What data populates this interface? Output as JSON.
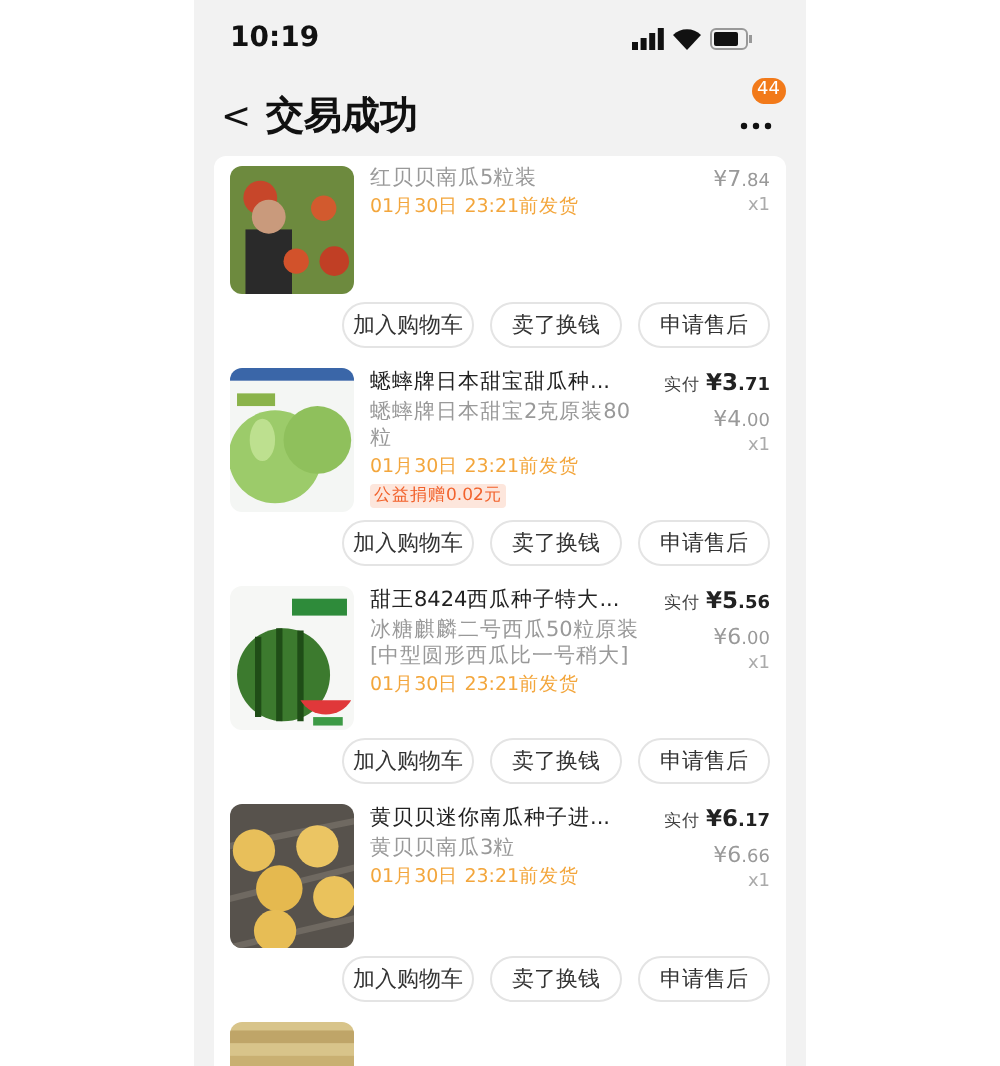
{
  "status_bar": {
    "time": "10:19"
  },
  "header": {
    "back": "<",
    "title": "交易成功",
    "more_badge": "44"
  },
  "items": [
    {
      "spec": "红贝贝南瓜5粒装",
      "price": "¥7.84",
      "quantity": "x1",
      "ship_date": "01月30日 23:21前发货",
      "picture": {
        "kind": "picture"
      },
      "buttons": [
        "加入购物车",
        "卖了换钱",
        "申请售后"
      ]
    },
    {
      "title": "蟋蟀牌日本甜宝甜瓜种...",
      "paid_label": "实付",
      "paid_price": "¥3.71",
      "spec": "蟋蟀牌日本甜宝2克原装80粒",
      "price": "¥4.00",
      "quantity": "x1",
      "ship_date": "01月30日 23:21前发货",
      "tag": "公益捐赠0.02元",
      "picture": {
        "kind": "picture"
      },
      "buttons": [
        "加入购物车",
        "卖了换钱",
        "申请售后"
      ]
    },
    {
      "title": "甜王8424西瓜种子特大...",
      "paid_label": "实付",
      "paid_price": "¥5.56",
      "spec": "冰糖麒麟二号西瓜50粒原装[中型圆形西瓜比一号稍大]",
      "price": "¥6.00",
      "quantity": "x1",
      "ship_date": "01月30日 23:21前发货",
      "picture": {
        "kind": "picture"
      },
      "buttons": [
        "加入购物车",
        "卖了换钱",
        "申请售后"
      ]
    },
    {
      "title": "黄贝贝迷你南瓜种子进...",
      "paid_label": "实付",
      "paid_price": "¥6.17",
      "spec": "黄贝贝南瓜3粒",
      "price": "¥6.66",
      "quantity": "x1",
      "ship_date": "01月30日 23:21前发货",
      "picture": {
        "kind": "picture"
      },
      "buttons": [
        "加入购物车",
        "卖了换钱",
        "申请售后"
      ]
    },
    {
      "picture": {
        "kind": "picture"
      }
    }
  ]
}
